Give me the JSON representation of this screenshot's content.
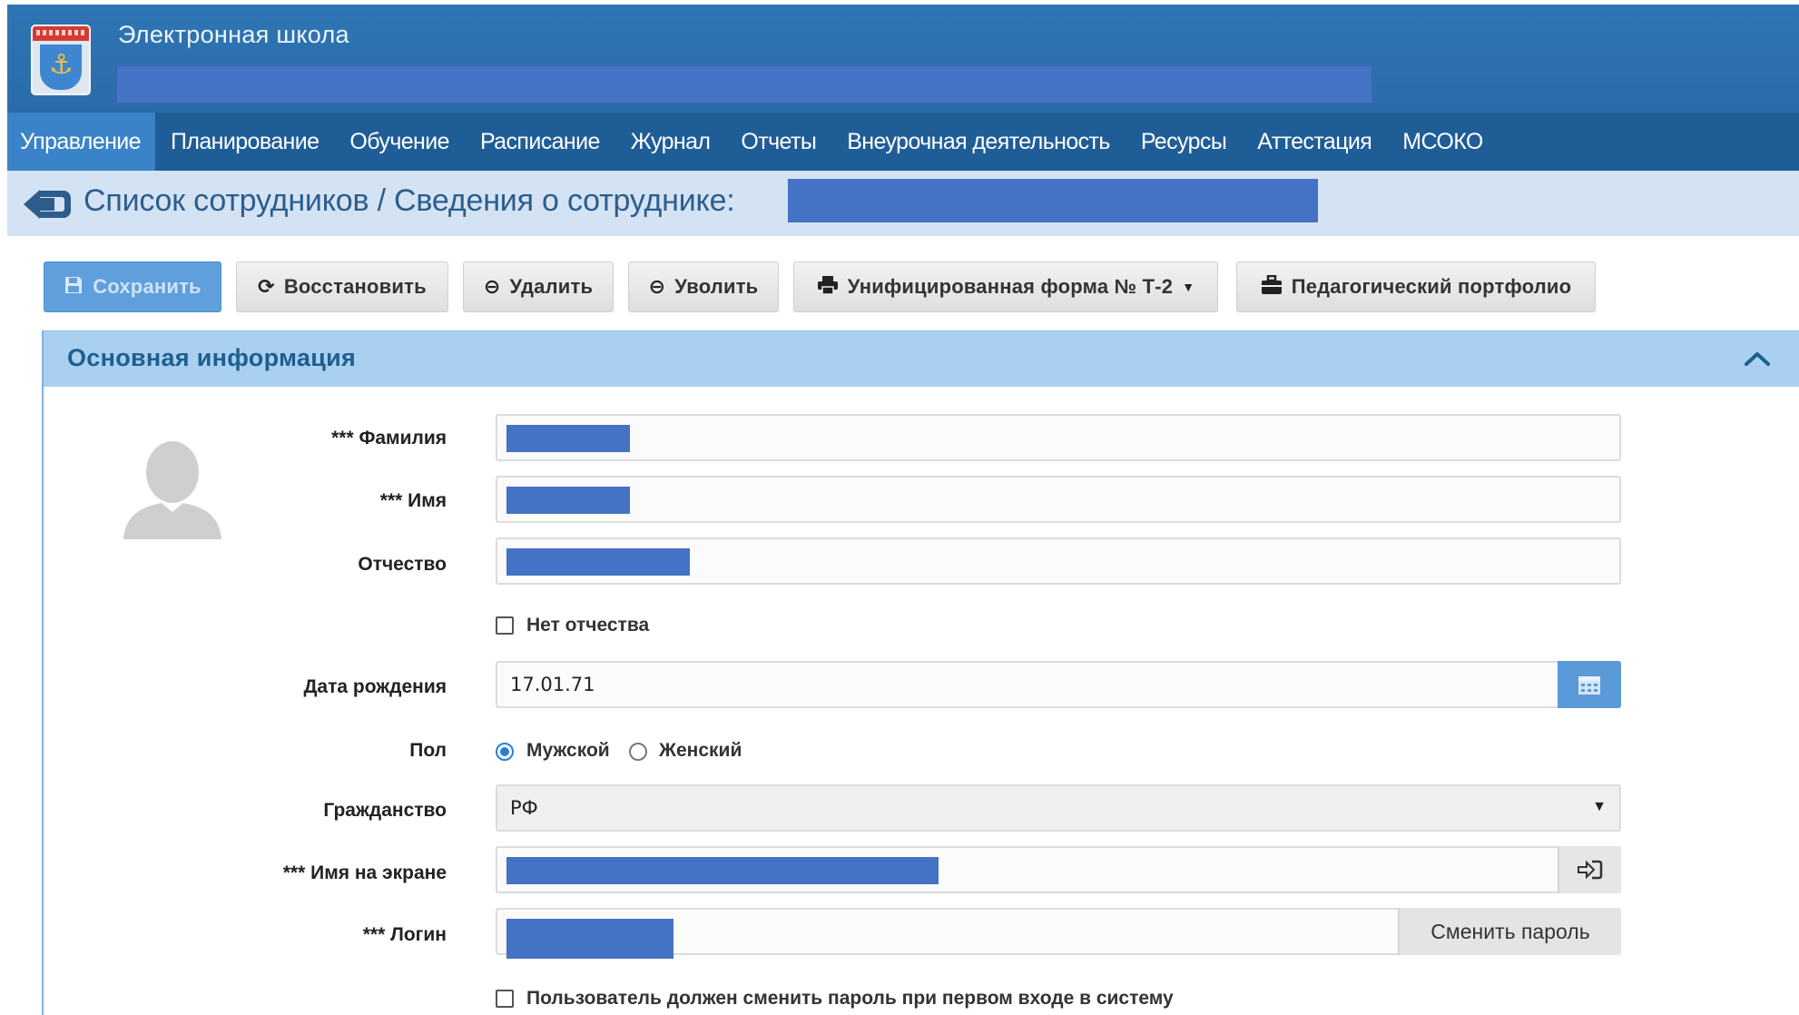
{
  "header": {
    "app_title": "Электронная школа"
  },
  "nav": {
    "items": [
      {
        "label": "Управление",
        "active": true
      },
      {
        "label": "Планирование",
        "active": false
      },
      {
        "label": "Обучение",
        "active": false
      },
      {
        "label": "Расписание",
        "active": false
      },
      {
        "label": "Журнал",
        "active": false
      },
      {
        "label": "Отчеты",
        "active": false
      },
      {
        "label": "Внеурочная деятельность",
        "active": false
      },
      {
        "label": "Ресурсы",
        "active": false
      },
      {
        "label": "Аттестация",
        "active": false
      },
      {
        "label": "МСОКО",
        "active": false
      }
    ]
  },
  "breadcrumb": {
    "title": "Список сотрудников / Сведения о сотруднике:"
  },
  "toolbar": {
    "save_label": "Сохранить",
    "restore_label": "Восстановить",
    "delete_label": "Удалить",
    "dismiss_label": "Уволить",
    "form_label": "Унифицированная форма № Т-2",
    "portfolio_label": "Педагогический портфолио"
  },
  "panel": {
    "title": "Основная информация"
  },
  "form": {
    "last_name_label": "*** Фамилия",
    "first_name_label": "*** Имя",
    "patronymic_label": "Отчество",
    "no_patronymic_label": "Нет отчества",
    "birth_date_label": "Дата рождения",
    "birth_date_value": "17.01.71",
    "gender_label": "Пол",
    "gender_male": "Мужской",
    "gender_female": "Женский",
    "gender_selected": "Мужской",
    "citizenship_label": "Гражданство",
    "citizenship_value": "РФ",
    "screen_name_label": "*** Имя на экране",
    "login_label": "*** Логин",
    "change_password_label": "Сменить пароль",
    "must_change_password_label": "Пользователь должен сменить пароль при первом входе в систему"
  },
  "colors": {
    "header_blue": "#2f76b4",
    "nav_blue": "#1f5d97",
    "nav_active": "#3a83c8",
    "redaction": "#4472c4",
    "panel_head": "#a9d0f0"
  },
  "icons": {
    "back": "arrow-left-circle-icon",
    "save": "floppy-disk-icon",
    "restore": "refresh-icon",
    "delete": "minus-circle-icon",
    "dismiss": "minus-circle-icon",
    "print": "printer-icon",
    "portfolio": "briefcase-icon",
    "collapse": "chevron-up-icon",
    "calendar": "calendar-icon",
    "sign_in": "sign-in-icon",
    "avatar": "user-silhouette-icon"
  }
}
